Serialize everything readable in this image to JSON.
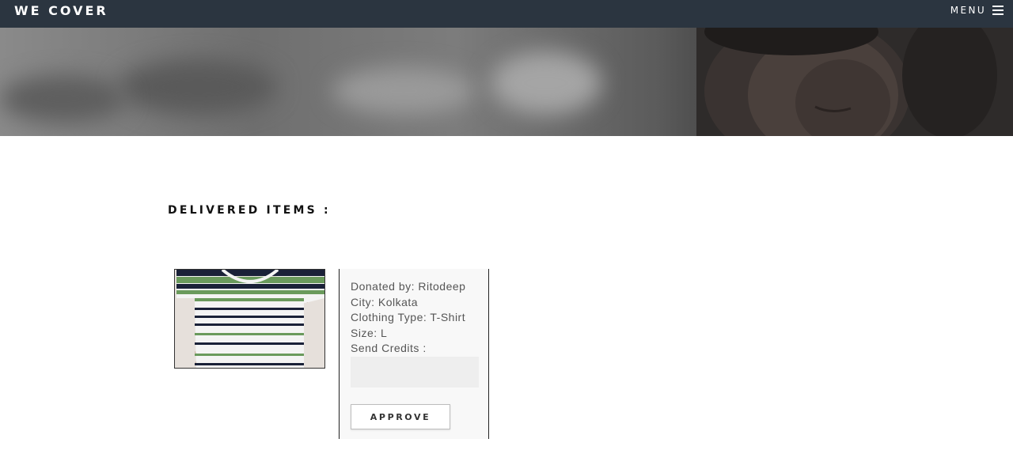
{
  "nav": {
    "brand": "WE COVER",
    "menu_label": "MENU",
    "menu_icon": "hamburger-icon"
  },
  "hero": {
    "description_icon": "hero-banner-image"
  },
  "section": {
    "title": "DELIVERED ITEMS :"
  },
  "item": {
    "image_icon": "striped-tshirt-photo",
    "donated_by": "Donated by: Ritodeep",
    "city": "City: Kolkata",
    "clothing_type": "Clothing Type: T-Shirt",
    "size": "Size: L",
    "credits_label": "Send Credits :",
    "credits_value": "",
    "approve_label": "APPROVE"
  },
  "colors": {
    "nav_bg": "#2b3540",
    "card_bg": "#f8f8f8",
    "input_bg": "#eeeeee",
    "stripe_green": "#6a9a5c",
    "stripe_navy": "#1a2138"
  }
}
